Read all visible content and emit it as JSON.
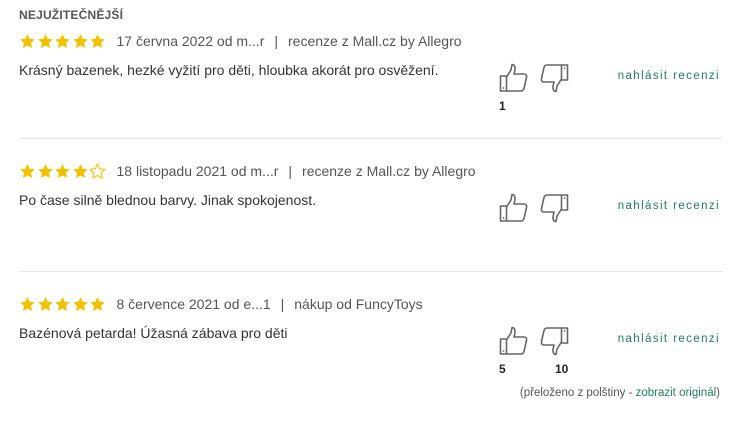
{
  "section": {
    "heading": "NEJUŽITEČNĚJŠÍ"
  },
  "colors": {
    "star": "#f2c200",
    "accent": "#1e7c61",
    "divider": "#e3e3e3"
  },
  "reviews": [
    {
      "rating": 5,
      "date_author": "17 června 2022 od m...r",
      "source": "recenze z Mall.cz by Allegro",
      "text": "Krásný bazenek, hezké vyžití pro děti, hloubka akorát pro osvěžení.",
      "likes": "1",
      "dislikes": "",
      "report": "nahlásit recenzi"
    },
    {
      "rating": 4,
      "date_author": "18 listopadu 2021 od m...r",
      "source": "recenze z Mall.cz by Allegro",
      "text": "Po čase silně blednou barvy. Jinak spokojenost.",
      "likes": "",
      "dislikes": "",
      "report": "nahlásit recenzi"
    },
    {
      "rating": 5,
      "date_author": "8 července 2021 od e...1",
      "source": "nákup od FuncyToys",
      "text": "Bazénová petarda! Úžasná zábava pro děti",
      "likes": "5",
      "dislikes": "10",
      "report": "nahlásit recenzi",
      "translation_note": "(přeloženo z polštiny - ",
      "translation_link": "zobrazit originál",
      "translation_close": ")"
    }
  ],
  "separator": "|"
}
